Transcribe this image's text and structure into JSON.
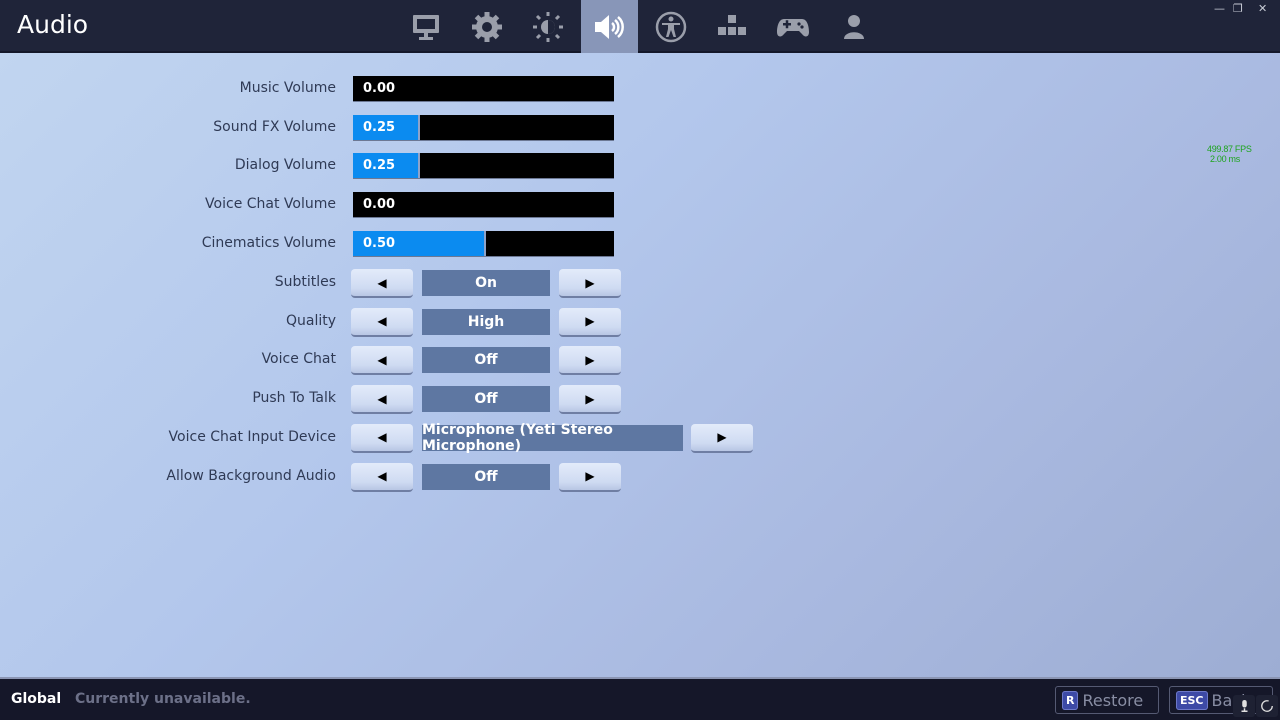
{
  "header": {
    "title": "Audio",
    "tabs": [
      {
        "name": "display",
        "icon": "monitor-icon",
        "active": false
      },
      {
        "name": "game",
        "icon": "gear-icon",
        "active": false
      },
      {
        "name": "brightness",
        "icon": "brightness-icon",
        "active": false
      },
      {
        "name": "audio",
        "icon": "speaker-icon",
        "active": true
      },
      {
        "name": "accessibility",
        "icon": "accessibility-icon",
        "active": false
      },
      {
        "name": "input",
        "icon": "keyboard-arrows-icon",
        "active": false
      },
      {
        "name": "controller",
        "icon": "gamepad-icon",
        "active": false
      },
      {
        "name": "account",
        "icon": "account-icon",
        "active": false
      }
    ],
    "window_controls": {
      "minimize": "—",
      "restore": "❐",
      "close": "✕"
    }
  },
  "overlay": {
    "fps": "499.87 FPS",
    "frame_time": "2.00 ms"
  },
  "sliders": [
    {
      "label": "Music Volume",
      "value": "0.00",
      "fraction": 0.0
    },
    {
      "label": "Sound FX Volume",
      "value": "0.25",
      "fraction": 0.25
    },
    {
      "label": "Dialog Volume",
      "value": "0.25",
      "fraction": 0.25
    },
    {
      "label": "Voice Chat Volume",
      "value": "0.00",
      "fraction": 0.0
    },
    {
      "label": "Cinematics Volume",
      "value": "0.50",
      "fraction": 0.5
    }
  ],
  "selectors": [
    {
      "label": "Subtitles",
      "value": "On"
    },
    {
      "label": "Quality",
      "value": "High"
    },
    {
      "label": "Voice Chat",
      "value": "Off"
    },
    {
      "label": "Push To Talk",
      "value": "Off"
    },
    {
      "label": "Voice Chat Input Device",
      "value": "Microphone (Yeti Stereo Microphone)"
    },
    {
      "label": "Allow Background Audio",
      "value": "Off"
    }
  ],
  "arrows": {
    "left": "◀",
    "right": "▶"
  },
  "footer": {
    "scope": "Global",
    "status": "Currently unavailable.",
    "restore": {
      "key": "R",
      "label": "Restore"
    },
    "back": {
      "key": "ESC",
      "label": "Back"
    }
  },
  "colors": {
    "accent": "#0b8bf0",
    "value_box": "#5e77a2",
    "topbar": "#1f2439",
    "active_tab": "#8896b8"
  }
}
